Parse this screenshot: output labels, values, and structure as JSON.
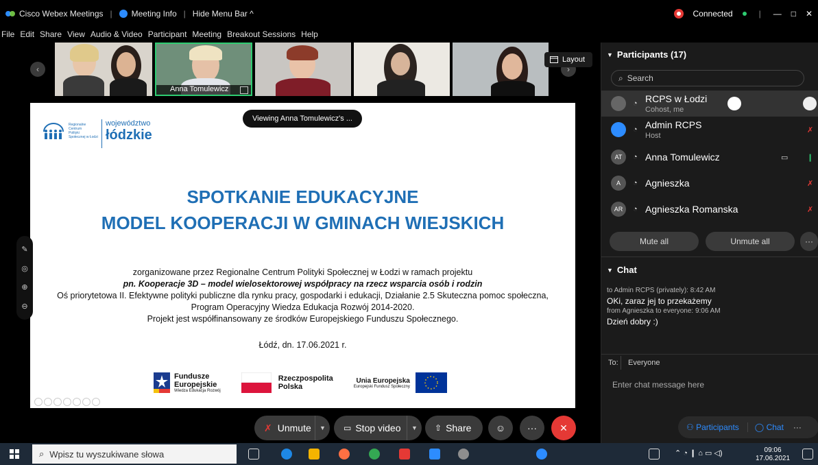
{
  "titlebar": {
    "app": "Cisco Webex Meetings",
    "meeting_info": "Meeting Info",
    "hide_menu": "Hide Menu Bar ^",
    "status": "Connected",
    "min": "—",
    "max": "□",
    "close": "✕"
  },
  "menubar": [
    "File",
    "Edit",
    "Share",
    "View",
    "Audio & Video",
    "Participant",
    "Meeting",
    "Breakout Sessions",
    "Help"
  ],
  "thumbs": {
    "active_name": "Anna Tomulewicz",
    "layout_label": "Layout"
  },
  "viewing": "Viewing Anna Tomulewicz's ...",
  "slide": {
    "rcps_logo_lines": [
      "Regionalne",
      "Centrum",
      "Polityki",
      "Społecznej w Łodzi"
    ],
    "lodzkie_small": "województwo",
    "lodzkie_big": "łódzkie",
    "title1": "SPOTKANIE EDUKACYJNE",
    "title2": "MODEL KOOPERACJI W GMINACH WIEJSKICH",
    "line1": "zorganizowane przez Regionalne Centrum Polityki Społecznej w Łodzi w ramach projektu",
    "line2": "pn. Kooperacje 3D – model wielosektorowej współpracy na rzecz wsparcia osób i rodzin",
    "line3": "Oś priorytetowa II. Efektywne polityki publiczne dla rynku pracy, gospodarki i edukacji, Działanie 2.5 Skuteczna pomoc społeczna,",
    "line4": "Program Operacyjny Wiedza Edukacja Rozwój 2014-2020.",
    "line5": "Projekt jest współfinansowany ze środków Europejskiego Funduszu Społecznego.",
    "date": "Łódź, dn. 17.06.2021 r.",
    "fe_1": "Fundusze",
    "fe_2": "Europejskie",
    "fe_3": "Wiedza Edukacja Rozwój",
    "rp_1": "Rzeczpospolita",
    "rp_2": "Polska",
    "ue_1": "Unia Europejska",
    "ue_2": "Europejski Fundusz Społeczny"
  },
  "controls": {
    "unmute": "Unmute",
    "stop_video": "Stop video",
    "share": "Share",
    "more": "···"
  },
  "participants": {
    "header": "Participants (17)",
    "search_placeholder": "Search",
    "list": [
      {
        "avatar": "",
        "name": "RCPS w Łodzi",
        "role": "Cohost, me"
      },
      {
        "avatar": "",
        "name": "Admin RCPS",
        "role": "Host"
      },
      {
        "avatar": "AT",
        "name": "Anna Tomulewicz",
        "role": ""
      },
      {
        "avatar": "A",
        "name": "Agnieszka",
        "role": ""
      },
      {
        "avatar": "AR",
        "name": "Agnieszka Romanska",
        "role": ""
      }
    ],
    "mute_all": "Mute all",
    "unmute_all": "Unmute all"
  },
  "chat": {
    "header": "Chat",
    "messages": [
      {
        "meta": "to Admin RCPS (privately):  8:42 AM",
        "text": "OKi, zaraz jej to przekażemy"
      },
      {
        "meta": "from Agnieszka to everyone:  9:06 AM",
        "text": "Dzień dobry :)"
      }
    ],
    "to_label": "To:",
    "to_value": "Everyone",
    "input_placeholder": "Enter chat message here"
  },
  "panel_tabs": {
    "participants": "Participants",
    "chat": "Chat"
  },
  "taskbar": {
    "search_placeholder": "Wpisz tu wyszukiwane słowa",
    "time": "09:06",
    "date": "17.06.2021"
  }
}
